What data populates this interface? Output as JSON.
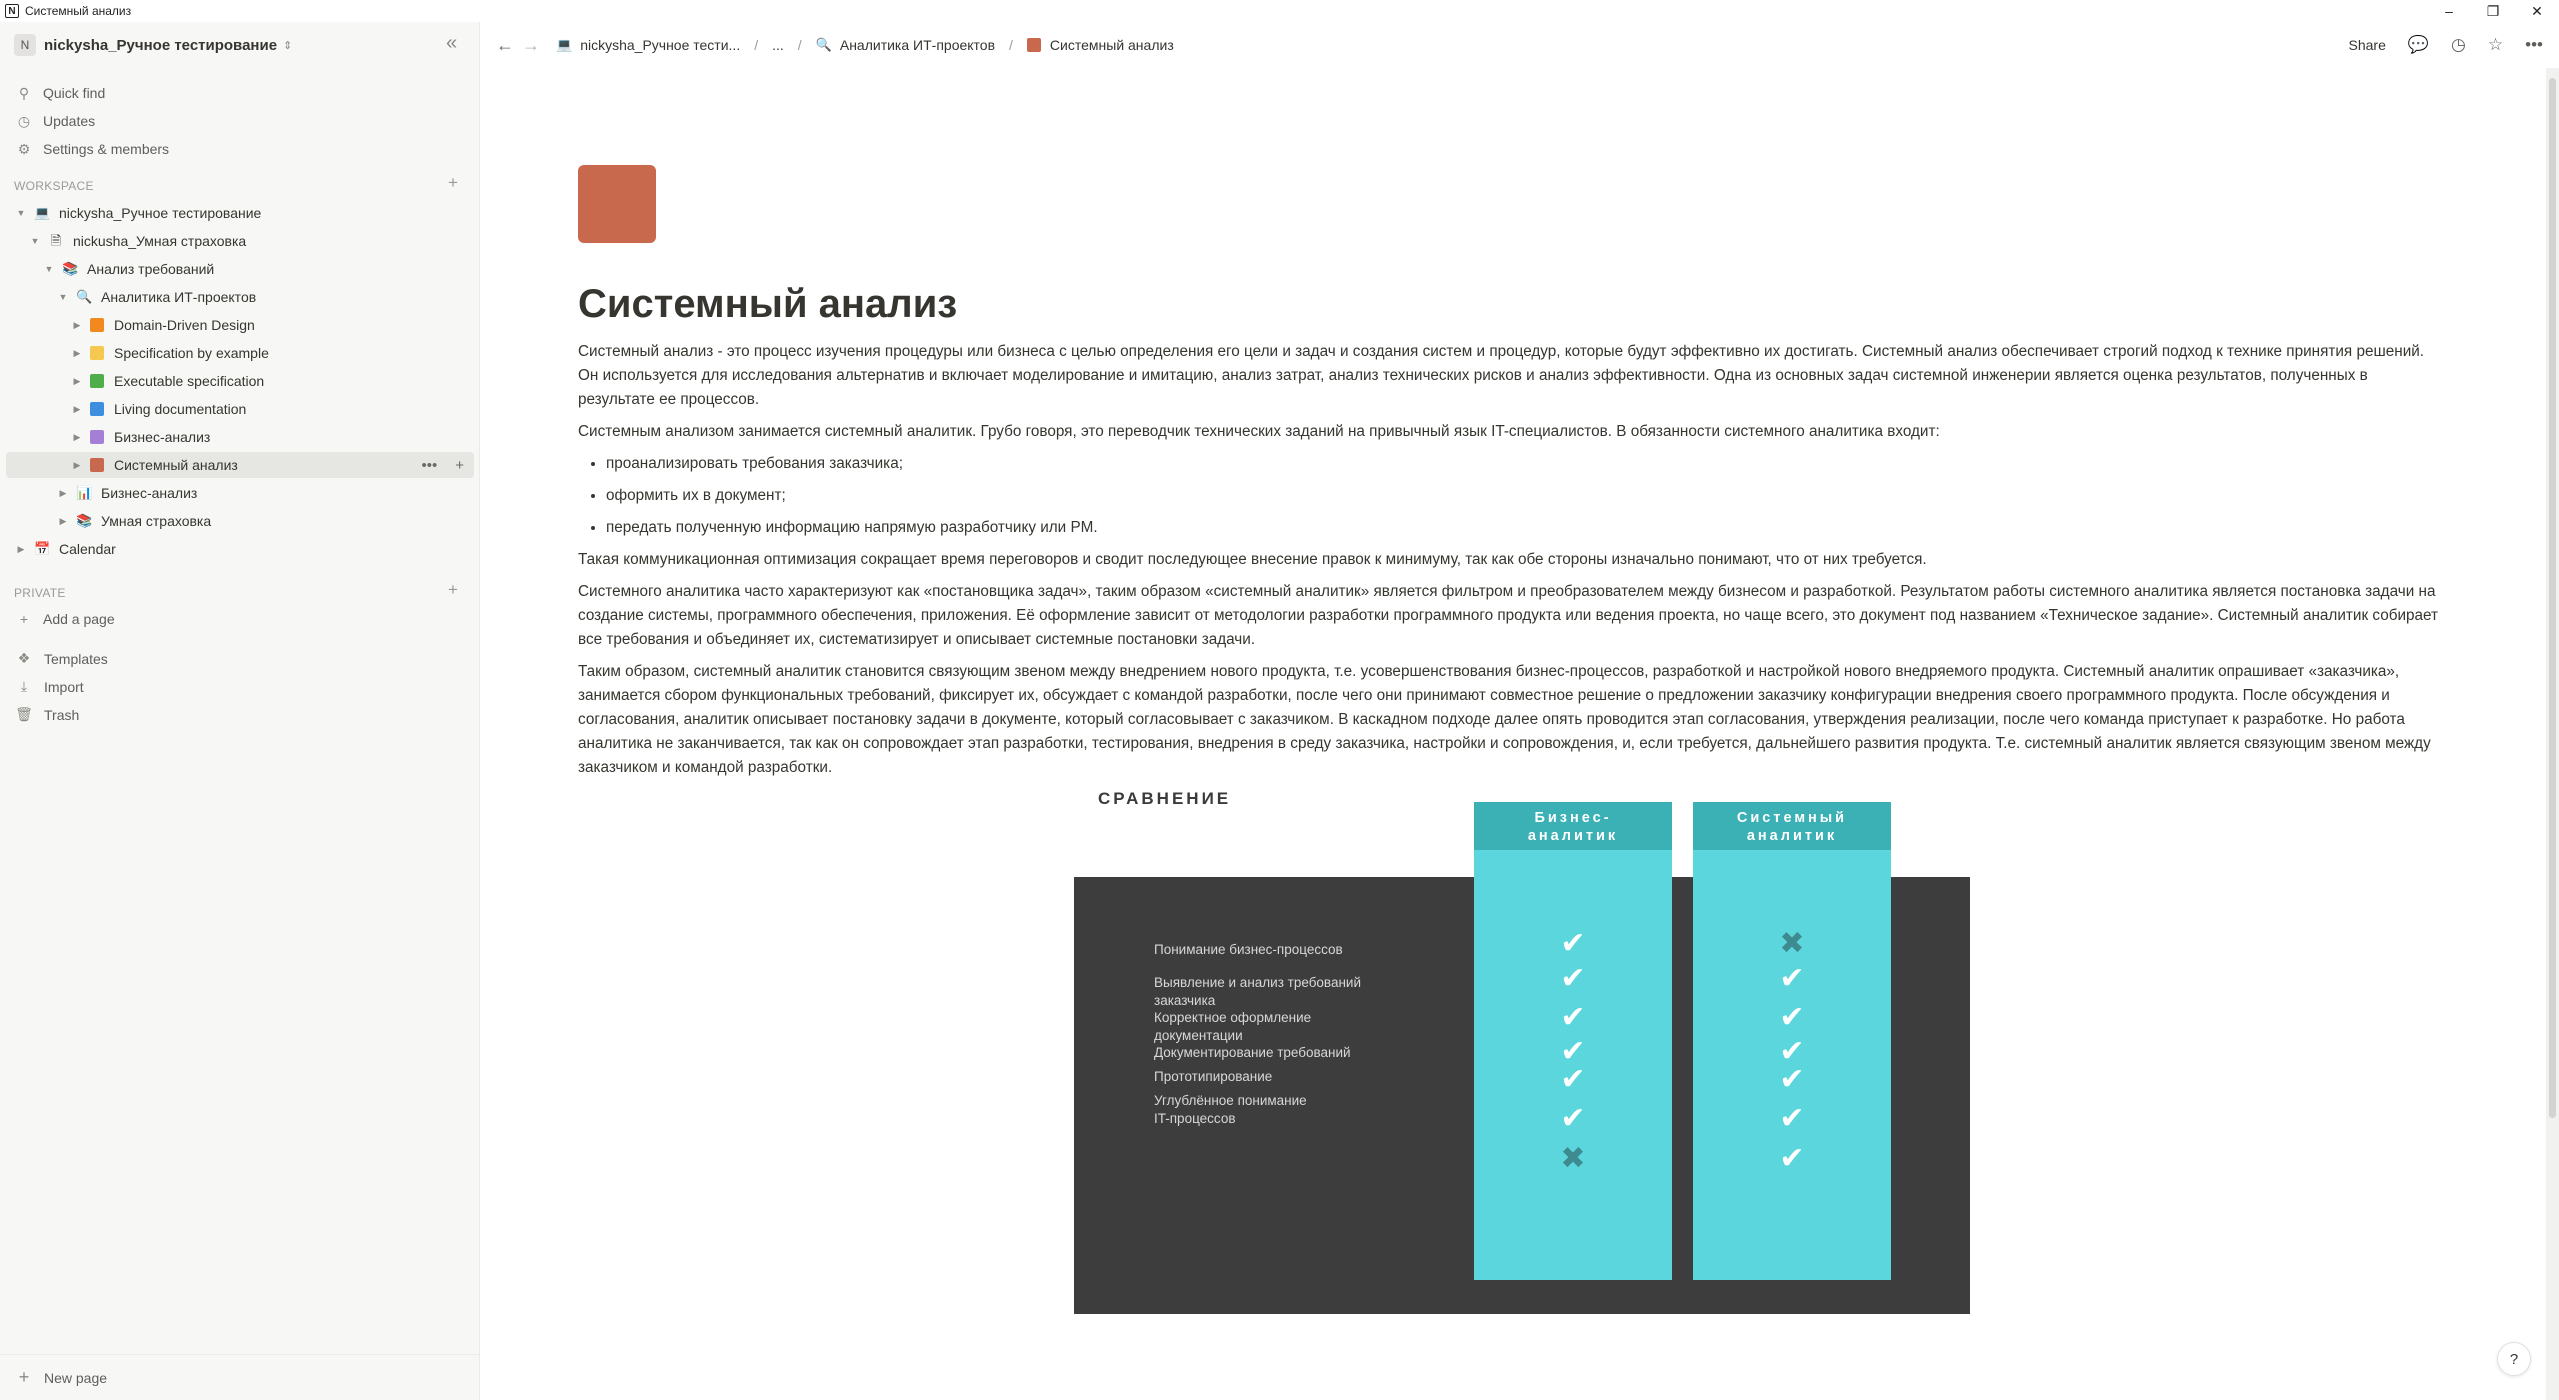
{
  "window": {
    "title": "Системный анализ",
    "controls": {
      "minimize": "–",
      "restore": "❐",
      "close": "✕"
    }
  },
  "sidebar": {
    "workspace_avatar": "N",
    "workspace_name": "nickysha_Ручное тестирование",
    "top_items": [
      {
        "label": "Quick find",
        "icon": "search-icon"
      },
      {
        "label": "Updates",
        "icon": "clock-icon"
      },
      {
        "label": "Settings & members",
        "icon": "gear-icon"
      }
    ],
    "workspace_label": "WORKSPACE",
    "tree": [
      {
        "label": "nickysha_Ручное тестирование",
        "icon": "laptop-icon",
        "expanded": true
      },
      {
        "label": "nickusha_Умная страховка",
        "icon": "page-icon",
        "expanded": true
      },
      {
        "label": "Анализ требований",
        "icon": "books-icon",
        "expanded": true
      },
      {
        "label": "Аналитика ИТ-проектов",
        "icon": "magnifier-icon",
        "expanded": true
      },
      {
        "label": "Domain-Driven Design",
        "color": "#f2891f",
        "expanded": false
      },
      {
        "label": "Specification by example",
        "color": "#f5c94f",
        "expanded": false
      },
      {
        "label": "Executable specification",
        "color": "#4fae4a",
        "expanded": false
      },
      {
        "label": "Living documentation",
        "color": "#3f8fe0",
        "expanded": false
      },
      {
        "label": "Бизнес-анализ",
        "color": "#a57fd6",
        "expanded": false
      },
      {
        "label": "Системный анализ",
        "color": "#c8694d",
        "expanded": false,
        "active": true
      },
      {
        "label": "Бизнес-анализ",
        "icon": "chart-icon",
        "expanded": false
      },
      {
        "label": "Умная страховка",
        "icon": "books-icon",
        "expanded": false
      },
      {
        "label": "Calendar",
        "icon": "calendar-icon",
        "expanded": false
      }
    ],
    "private_label": "PRIVATE",
    "add_page": "Add a page",
    "bottom_items": [
      {
        "label": "Templates",
        "icon": "templates-icon"
      },
      {
        "label": "Import",
        "icon": "download-icon"
      },
      {
        "label": "Trash",
        "icon": "trash-icon"
      }
    ],
    "new_page": "New page"
  },
  "topbar": {
    "breadcrumbs": [
      "nickysha_Ручное тести...",
      "...",
      "Аналитика ИТ-проектов",
      "Системный анализ"
    ],
    "share": "Share"
  },
  "page": {
    "icon_color": "#c8694d",
    "title": "Системный анализ",
    "paragraphs": [
      "Системный анализ - это процесс изучения процедуры или бизнеса с целью определения его цели и задач и создания систем и процедур, которые будут эффективно их достигать. Системный анализ обеспечивает строгий подход к технике принятия решений. Он используется для исследования альтернатив и включает моделирование и имитацию, анализ затрат, анализ технических рисков и анализ эффективности. Одна из основных задач системной инженерии является оценка результатов, полученных в результате ее процессов.",
      "Системным анализом занимается системный аналитик. Грубо говоря, это переводчик технических заданий на привычный язык IT-специалистов. В обязанности системного аналитика входит:"
    ],
    "bullets": [
      "проанализировать требования заказчика;",
      "оформить их в документ;",
      "передать полученную информацию напрямую разработчику или PM."
    ],
    "paragraphs_after": [
      "Такая коммуникационная оптимизация сокращает время переговоров и сводит последующее внесение правок к минимуму, так как обе стороны изначально понимают, что от них требуется.",
      "Системного аналитика часто характеризуют как «постановщика задач», таким образом «системный аналитик» является фильтром и преобразователем между бизнесом и разработкой. Результатом работы системного аналитика является постановка задачи на создание системы, программного обеспечения, приложения. Её оформление зависит от методологии разработки программного продукта или ведения проекта, но чаще всего, это документ под названием «Техническое задание». Системный аналитик собирает все требования и объединяет их, систематизирует и описывает системные постановки задачи.",
      "Таким образом, системный аналитик становится связующим звеном между внедрением нового продукта, т.е. усовершенствования бизнес-процессов, разработкой и настройкой нового внедряемого продукта. Системный аналитик опрашивает «заказчика», занимается сбором функциональных требований, фиксирует их, обсуждает с командой разработки, после чего они принимают совместное решение о предложении заказчику конфигурации внедрения своего программного продукта. После обсуждения и согласования, аналитик описывает постановку задачи в документе, который согласовывает с заказчиком. В каскадном подходе далее опять проводится этап согласования, утверждения реализации, после чего команда приступает к разработке. Но работа аналитика не заканчивается, так как он сопровождает этап разработки, тестирования, внедрения в среду заказчика, настройки и сопровождения, и, если требуется, дальнейшего развития продукта. Т.е. системный аналитик является связующим звеном между заказчиком и командой разработки."
    ]
  },
  "comparison": {
    "heading": "СРАВНЕНИЕ",
    "columns": [
      "Бизнес-аналитик",
      "Системный аналитик"
    ],
    "rows": [
      {
        "label": "Понимание бизнес-процессов",
        "business": true,
        "system": false
      },
      {
        "label": "Выявление и анализ требований заказчика",
        "business": true,
        "system": true
      },
      {
        "label": "Корректное оформление документации",
        "business": true,
        "system": true
      },
      {
        "label": "Документирование требований",
        "business": true,
        "system": true
      },
      {
        "label": "Прототипирование",
        "business": true,
        "system": true
      },
      {
        "label": "Углублённое понимание IT-процессов",
        "business": true,
        "system": true
      },
      {
        "label": "",
        "business": false,
        "system": true
      }
    ],
    "check_glyph": "✔",
    "cross_glyph": "✖"
  },
  "help": "?"
}
